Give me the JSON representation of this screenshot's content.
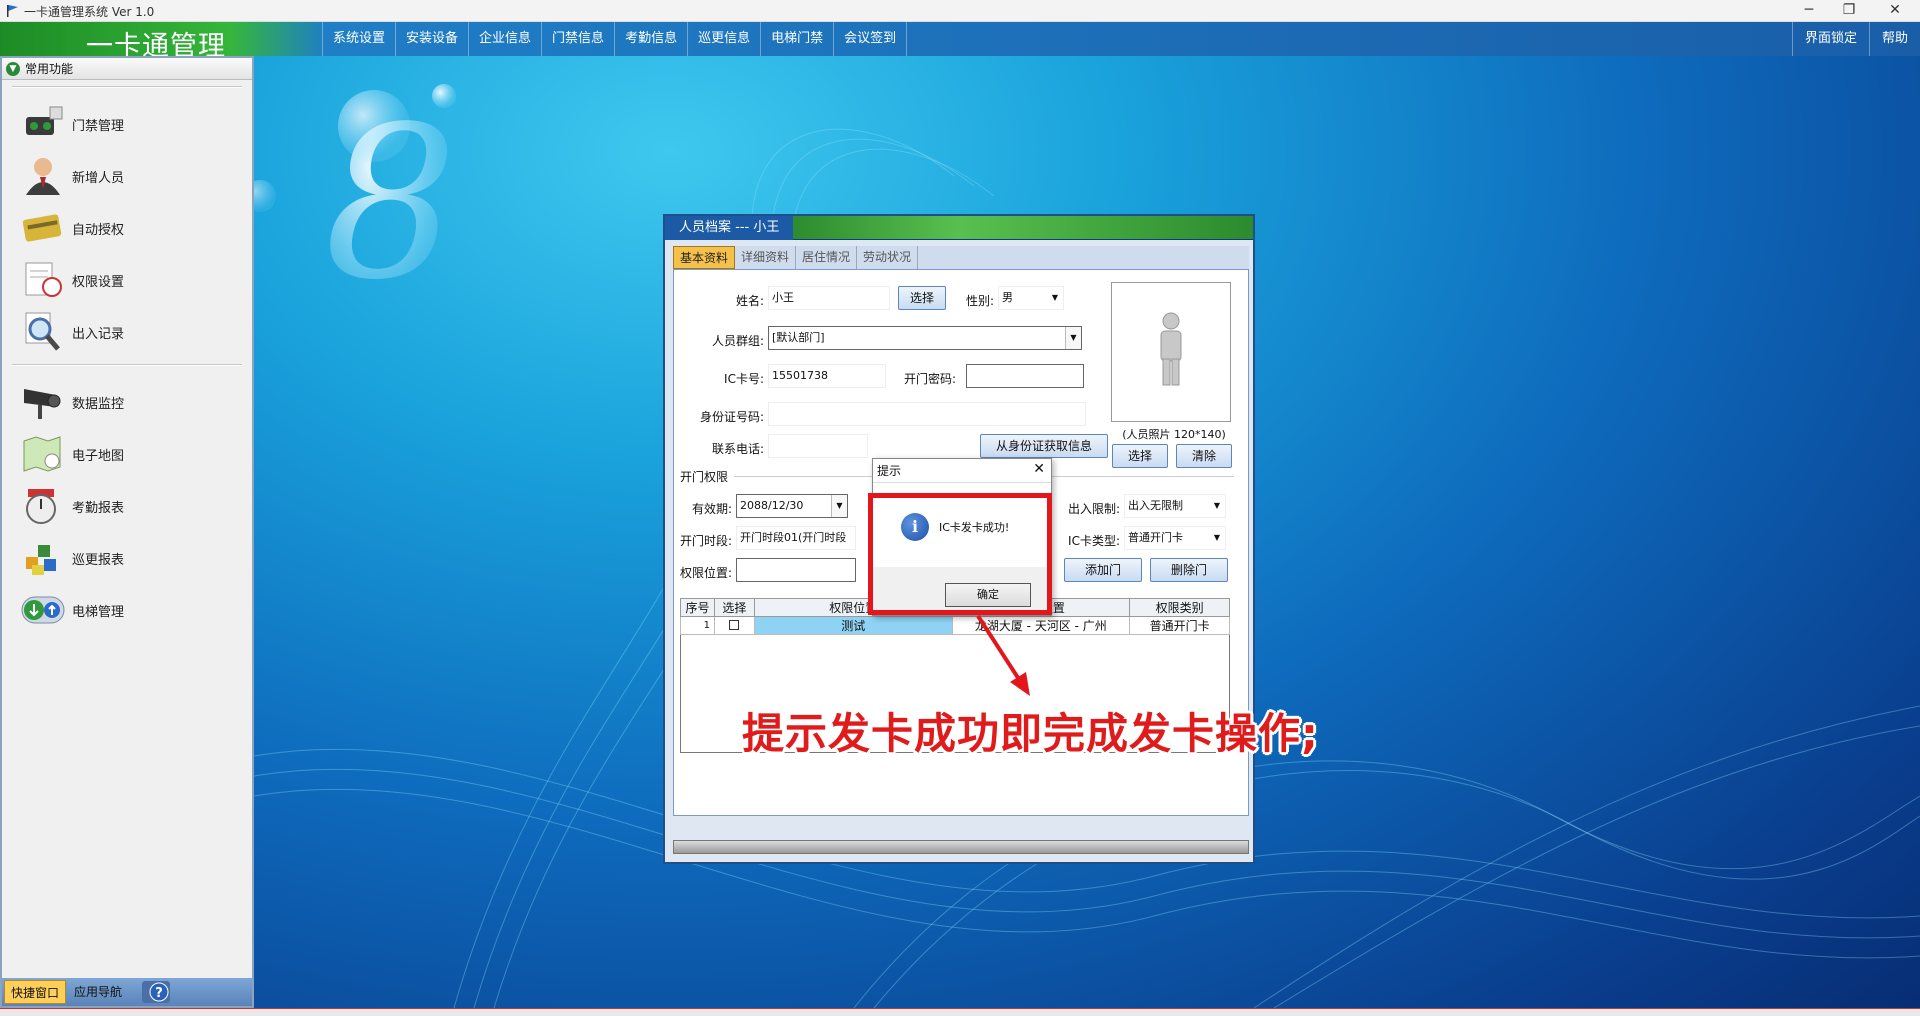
{
  "window": {
    "title": "一卡通管理系统 Ver 1.0",
    "buttons": [
      "─",
      "❐",
      "✕"
    ]
  },
  "menubar": {
    "brand": "一卡通管理",
    "items": [
      "系统设置",
      "安装设备",
      "企业信息",
      "门禁信息",
      "考勤信息",
      "巡更信息",
      "电梯门禁",
      "会议签到"
    ],
    "right_items": [
      "界面锁定",
      "帮助"
    ]
  },
  "sidebar": {
    "header": "常用功能",
    "group1": [
      "门禁管理",
      "新增人员",
      "自动授权",
      "权限设置",
      "出入记录"
    ],
    "group2": [
      "数据监控",
      "电子地图",
      "考勤报表",
      "巡更报表",
      "电梯管理"
    ],
    "tabs": [
      "快捷窗口",
      "应用导航"
    ],
    "help_icon": "question-icon"
  },
  "record_window": {
    "title": "人员档案 --- 小王",
    "tabs": [
      "基本资料",
      "详细资料",
      "居住情况",
      "劳动状况"
    ],
    "fields": {
      "name_label": "姓名:",
      "name_value": "小王",
      "select_button": "选择",
      "gender_label": "性别:",
      "gender_value": "男",
      "group_label": "人员群组:",
      "group_value": "[默认部门]",
      "card_label": "IC卡号:",
      "card_value": "15501738",
      "door_pwd_label": "开门密码:",
      "door_pwd_value": "",
      "id_label": "身份证号码:",
      "id_value": "",
      "phone_label": "联系电话:",
      "phone_value": "",
      "read_id_button": "从身份证获取信息",
      "photo_select_button": "选择",
      "photo_clear_button": "清除",
      "photo_caption": "(人员照片 120*140)"
    },
    "access": {
      "section_title": "开门权限",
      "valid_label": "有效期:",
      "valid_value": "2088/12/30",
      "time_label": "开门时段:",
      "time_value": "开门时段01(开门时段",
      "io_limit_label": "出入限制:",
      "io_limit_value": "出入无限制",
      "card_type_label": "IC卡类型:",
      "card_type_value": "普通开门卡",
      "position_label": "权限位置:",
      "position_value": "",
      "add_door_button": "添加门",
      "delete_door_button": "删除门"
    },
    "table": {
      "headers": [
        "序号",
        "选择",
        "权限位置",
        "安装位置",
        "权限类别"
      ],
      "rows": [
        {
          "index": "1",
          "selected": false,
          "position": "测试",
          "install": "龙湖大厦 - 天河区 - 广州",
          "category": "普通开门卡"
        }
      ]
    }
  },
  "dialog": {
    "title": "提示",
    "close": "✕",
    "message": "IC卡发卡成功!",
    "ok_button": "确定"
  },
  "annotation": {
    "text": "提示发卡成功即完成发卡操作;",
    "color": "#e01b1b"
  }
}
